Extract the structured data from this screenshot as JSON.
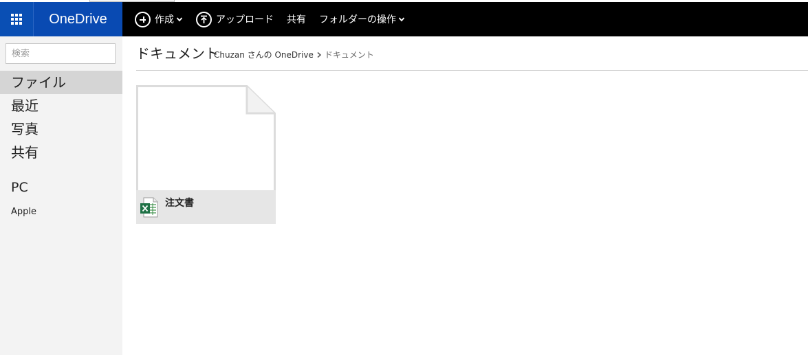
{
  "app": {
    "brand": "OneDrive",
    "brand_color": "#094ab2"
  },
  "toolbar": {
    "create_label": "作成",
    "upload_label": "アップロード",
    "share_label": "共有",
    "folder_ops_label": "フォルダーの操作"
  },
  "sidebar": {
    "search_placeholder": "検索",
    "items": [
      {
        "label": "ファイル",
        "active": true
      },
      {
        "label": "最近",
        "active": false
      },
      {
        "label": "写真",
        "active": false
      },
      {
        "label": "共有",
        "active": false
      }
    ],
    "pc_section": "PC",
    "pc_device": "Apple"
  },
  "main": {
    "title": "ドキュメント",
    "breadcrumb": {
      "root": "Chuzan さんの OneDrive",
      "current": "ドキュメント"
    },
    "files": [
      {
        "name": "注文書",
        "icon": "excel-file-icon"
      }
    ]
  }
}
